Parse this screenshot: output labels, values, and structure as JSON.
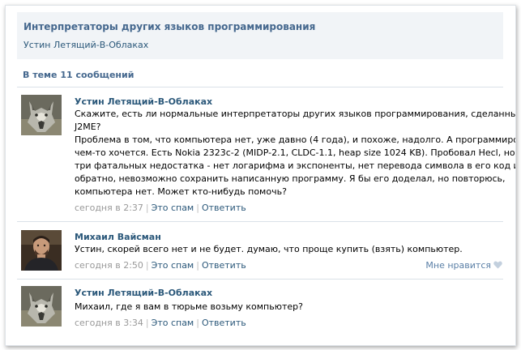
{
  "topic": {
    "title": "Интерпретаторы других языков программирования",
    "author": "Устин Летящий-В-Облаках"
  },
  "messages_count": "В теме 11 сообщений",
  "posts": [
    {
      "author": "Устин Летящий-В-Облаках",
      "avatar_icon": "wolf-avatar",
      "lines": [
        "Скажите, есть ли нормальные интерпретаторы других языков программирования, сделанные под",
        "J2ME?",
        "Проблема в том, что компьютера нет, уже давно (4 года), и похоже, надолго. А программировать на",
        "чем-то хочется. Есть Nokia 2323c-2 (MIDP-2.1, CLDC-1.1, heap size 1024 KB). Пробовал Hecl, но у него",
        "три фатальных недостатка - нет логарифма и экспоненты, нет перевода символа в его код и",
        "обратно, невозможно сохранить написанную программу. Я бы его доделал, но повторюсь,",
        "компьютера нет. Может кто-нибудь помочь?"
      ],
      "time": "сегодня в 2:37",
      "spam": "Это спам",
      "reply": "Ответить"
    },
    {
      "author": "Михаил Вайсман",
      "avatar_icon": "man-avatar",
      "lines": [
        "Устин, скорей всего нет и не будет. думаю, что проще купить (взять) компьютер."
      ],
      "time": "сегодня в 2:50",
      "spam": "Это спам",
      "reply": "Ответить",
      "like": "Мне нравится",
      "like_icon": "heart-icon"
    },
    {
      "author": "Устин Летящий-В-Облаках",
      "avatar_icon": "wolf-avatar",
      "lines": [
        "Михаил, где я вам в тюрьме возьму компьютер?"
      ],
      "time": "сегодня в 3:34",
      "spam": "Это спам",
      "reply": "Ответить"
    }
  ],
  "colors": {
    "link": "#2b587a",
    "header_bg": "#f1f4f7",
    "meta": "#999999"
  }
}
